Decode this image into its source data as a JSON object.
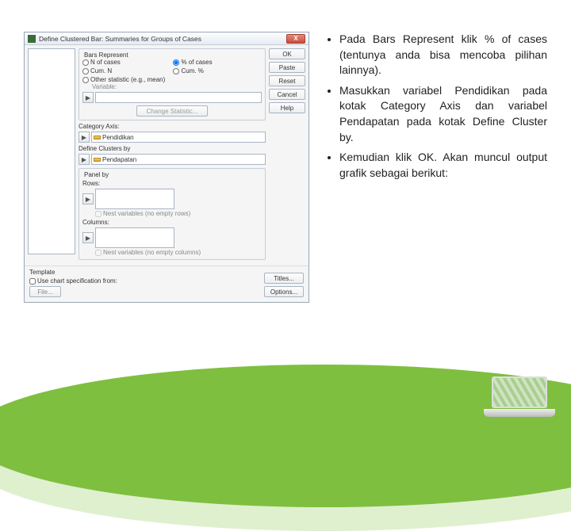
{
  "dialog": {
    "title": "Define Clustered Bar: Summaries for Groups of Cases",
    "close": "X",
    "bars_represent_label": "Bars Represent",
    "radios": {
      "n_of_cases": "N of cases",
      "pct_of_cases": "% of cases",
      "cum_n": "Cum. N",
      "cum_pct": "Cum. %",
      "other_stat": "Other statistic (e.g., mean)"
    },
    "variable_label": "Variable:",
    "change_stat_btn": "Change Statistic...",
    "category_axis_label": "Category Axis:",
    "category_axis_value": "Pendidikan",
    "define_clusters_label": "Define Clusters by",
    "define_clusters_value": "Pendapatan",
    "panel_by_label": "Panel by",
    "rows_label": "Rows:",
    "nest_rows": "Nest variables (no empty rows)",
    "columns_label": "Columns:",
    "nest_cols": "Nest variables (no empty columns)",
    "template_label": "Template",
    "use_chart_spec": "Use chart specification from:",
    "file_btn": "File...",
    "buttons": {
      "ok": "OK",
      "paste": "Paste",
      "reset": "Reset",
      "cancel": "Cancel",
      "help": "Help",
      "titles": "Titles...",
      "options": "Options..."
    }
  },
  "bullets": {
    "b1": "Pada Bars Represent klik % of cases (tentunya anda bisa mencoba pilihan lainnya).",
    "b2": "Masukkan variabel Pendidikan pada kotak Category Axis dan variabel Pendapatan pada kotak Define Cluster by.",
    "b3": "Kemudian klik OK. Akan muncul output grafik sebagai berikut:"
  }
}
